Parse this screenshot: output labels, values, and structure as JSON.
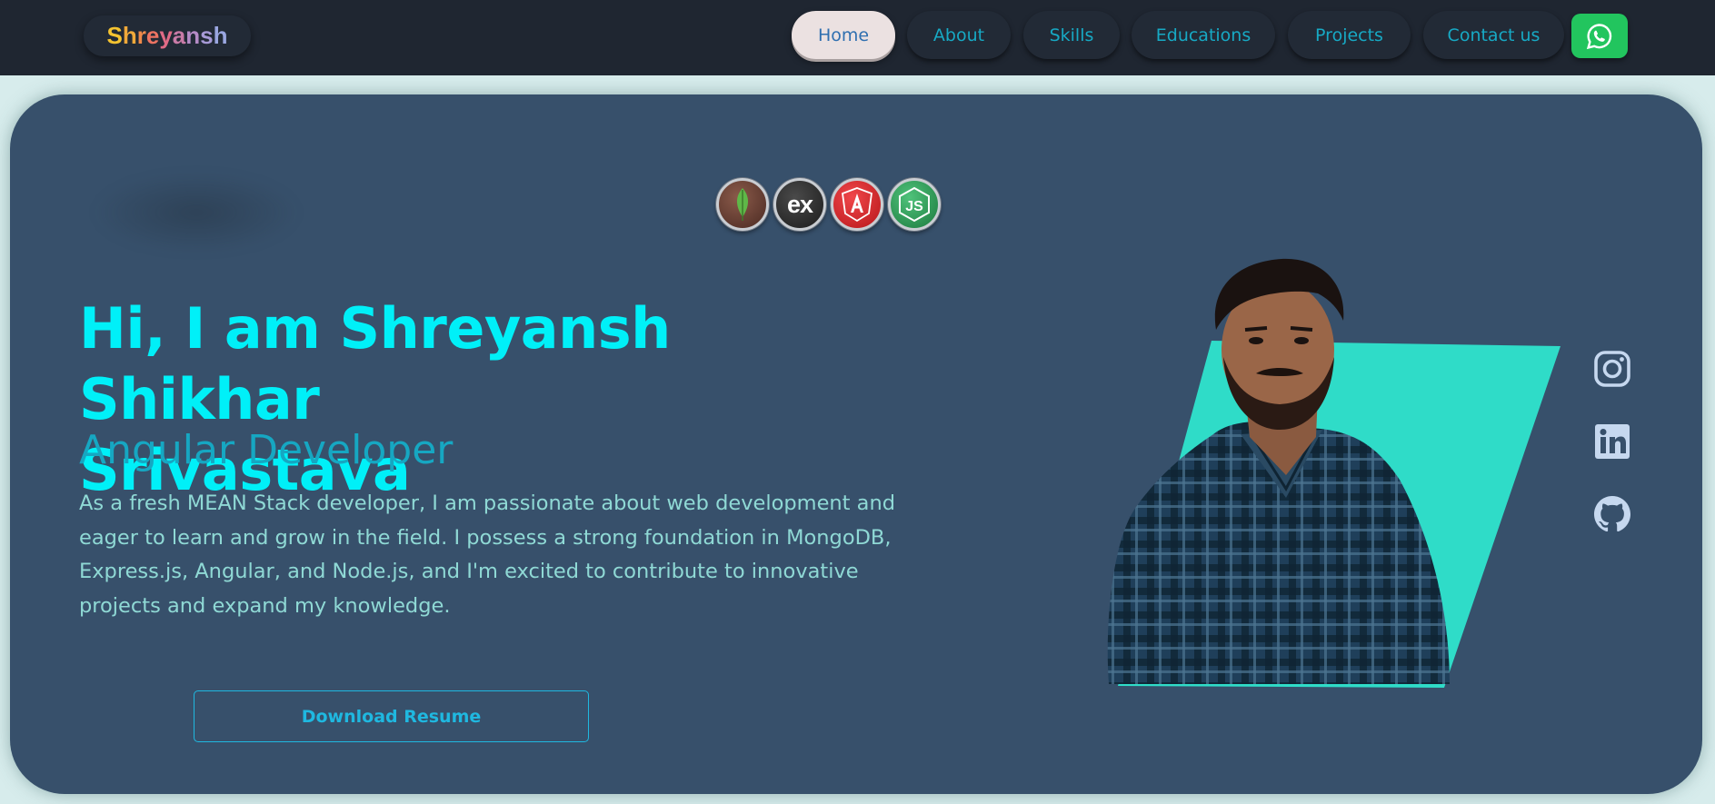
{
  "brand": {
    "letters": [
      "S",
      "h",
      "r",
      "e",
      "y",
      "a",
      "n",
      "s",
      "h"
    ],
    "colors": [
      "#f4c330",
      "#f0a93a",
      "#ef8a4a",
      "#ec7362",
      "#e06b86",
      "#c97ba7",
      "#b58bc6",
      "#a79ad7",
      "#9aa6e0"
    ]
  },
  "nav": {
    "items": [
      {
        "label": "Home",
        "active": true
      },
      {
        "label": "About"
      },
      {
        "label": "Skills"
      },
      {
        "label": "Educations"
      },
      {
        "label": "Projects"
      },
      {
        "label": "Contact us"
      }
    ],
    "whatsapp_icon": "whatsapp-icon"
  },
  "tech_icons": [
    "mongodb-icon",
    "express-icon",
    "angular-icon",
    "nodejs-icon"
  ],
  "hero": {
    "greeting_line1": "Hi, I am Shreyansh Shikhar",
    "greeting_line2": "Srivastava",
    "role": "Angular Developer",
    "bio": "As a fresh MEAN Stack developer, I am passionate about web development and eager to learn and grow in the field. I possess a strong foundation in MongoDB, Express.js, Angular, and Node.js, and I'm excited to contribute to innovative projects and expand my knowledge.",
    "resume_label": "Download Resume"
  },
  "social": [
    "instagram-icon",
    "linkedin-icon",
    "github-icon"
  ],
  "colors": {
    "accent": "#00f0f8",
    "card": "#37506b",
    "nav": "#1f2631",
    "teal": "#2fdcc8"
  }
}
